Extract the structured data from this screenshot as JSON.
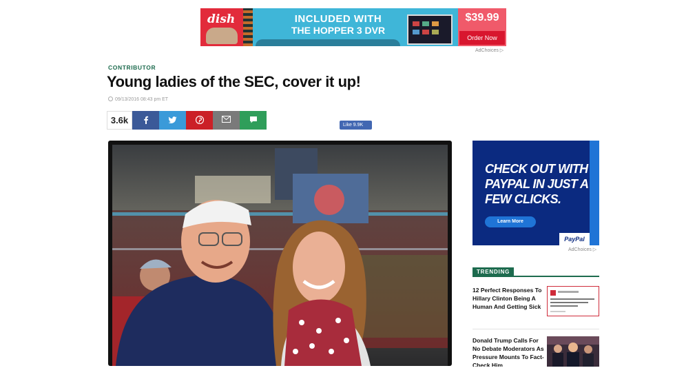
{
  "top_ad": {
    "brand": "dish",
    "line1": "INCLUDED WITH",
    "line2": "THE HOPPER 3 DVR",
    "price": "$39.99",
    "cta": "Order Now",
    "adchoices": "AdChoices ▷"
  },
  "article": {
    "eyebrow": "CONTRIBUTOR",
    "title": "Young ladies of the SEC, cover it up!",
    "timestamp": "09/13/2016 08:43 pm ET",
    "share_count": "3.6k",
    "share_buttons": [
      {
        "icon": "facebook-icon",
        "color": "#3b5998"
      },
      {
        "icon": "twitter-icon",
        "color": "#3a9ad9"
      },
      {
        "icon": "pinterest-icon",
        "color": "#cb2027"
      },
      {
        "icon": "email-icon",
        "color": "#7a7a7a"
      },
      {
        "icon": "comment-icon",
        "color": "#2f9e5a"
      }
    ],
    "fb_like": "Like 9.9K"
  },
  "sidebar": {
    "ad": {
      "text": "CHECK OUT WITH PAYPAL IN JUST A FEW CLICKS.",
      "button": "Learn More",
      "brand": "PayPal",
      "adchoices": "AdChoices ▷"
    },
    "trending_label": "TRENDING",
    "trending": [
      {
        "title": "12 Perfect Responses To Hillary Clinton Being A Human And Getting Sick"
      },
      {
        "title": "Donald Trump Calls For No Debate Moderators As Pressure Mounts To Fact-Check Him"
      }
    ]
  },
  "colors": {
    "accent_green": "#1d6b4e",
    "dish_red": "#e22b3b",
    "paypal_navy": "#0b2a80"
  }
}
